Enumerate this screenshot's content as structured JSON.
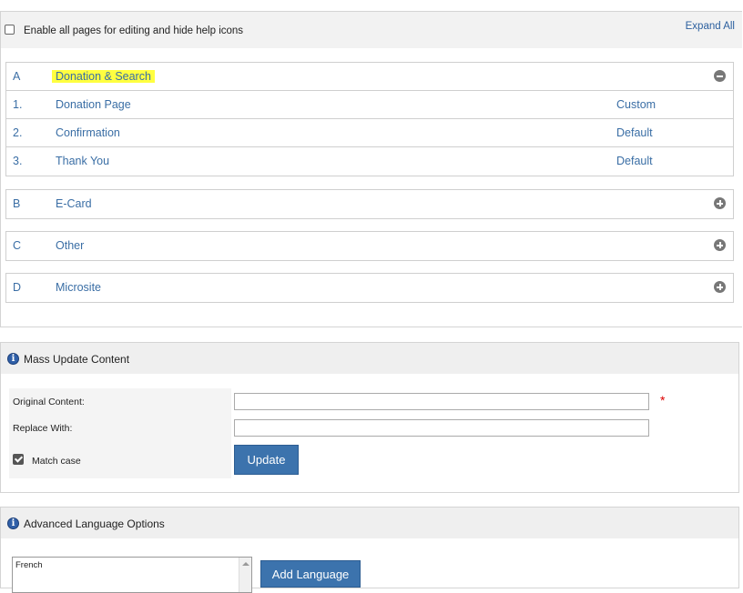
{
  "topbar": {
    "enable_label": "Enable all pages for editing and hide help icons",
    "expand_all": "Expand All"
  },
  "sections": [
    {
      "letter": "A",
      "name": "Donation & Search",
      "expanded": true,
      "pages": [
        {
          "num": "1.",
          "name": "Donation Page",
          "status": "Custom"
        },
        {
          "num": "2.",
          "name": "Confirmation",
          "status": "Default"
        },
        {
          "num": "3.",
          "name": "Thank You",
          "status": "Default"
        }
      ]
    },
    {
      "letter": "B",
      "name": "E-Card",
      "expanded": false
    },
    {
      "letter": "C",
      "name": "Other",
      "expanded": false
    },
    {
      "letter": "D",
      "name": "Microsite",
      "expanded": false
    }
  ],
  "mass_update": {
    "title": "Mass Update Content",
    "original_label": "Original Content:",
    "replace_label": "Replace With:",
    "match_case_label": "Match case",
    "required_mark": "*",
    "update_button": "Update"
  },
  "language": {
    "title": "Advanced Language Options",
    "list_options": [
      "French"
    ],
    "add_button": "Add Language"
  },
  "colors": {
    "link": "#3a6ea5",
    "highlight": "#ffff40",
    "button": "#3c73ad",
    "info_icon": "#2f5fa8",
    "required": "#dd0000"
  }
}
